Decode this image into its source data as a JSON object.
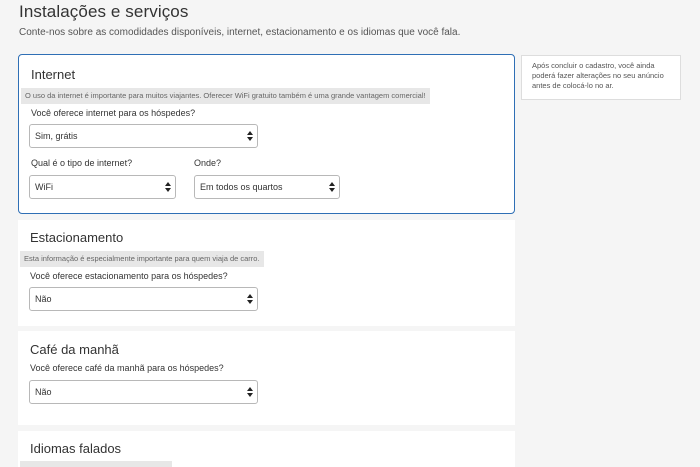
{
  "page": {
    "title": "Instalações e serviços",
    "subtitle": "Conte-nos sobre as comodidades disponíveis, internet, estacionamento e os idiomas que você fala."
  },
  "side_note": {
    "text": "Após concluir o cadastro, você ainda poderá fazer alterações no seu anúncio antes de colocá-lo no ar."
  },
  "internet": {
    "title": "Internet",
    "hint": "O uso da internet é importante para muitos viajantes. Oferecer WiFi gratuito também é uma grande vantagem comercial!",
    "offer_question": "Você oferece internet para os hóspedes?",
    "offer_value": "Sim, grátis",
    "type_question": "Qual é o tipo de internet?",
    "type_value": "WiFi",
    "where_question": "Onde?",
    "where_value": "Em todos os quartos"
  },
  "parking": {
    "title": "Estacionamento",
    "hint": "Esta informação é especialmente importante para quem viaja de carro.",
    "question": "Você oferece estacionamento para os hóspedes?",
    "value": "Não"
  },
  "breakfast": {
    "title": "Café da manhã",
    "question": "Você oferece café da manhã para os hóspedes?",
    "value": "Não"
  },
  "languages": {
    "title": "Idiomas falados"
  }
}
